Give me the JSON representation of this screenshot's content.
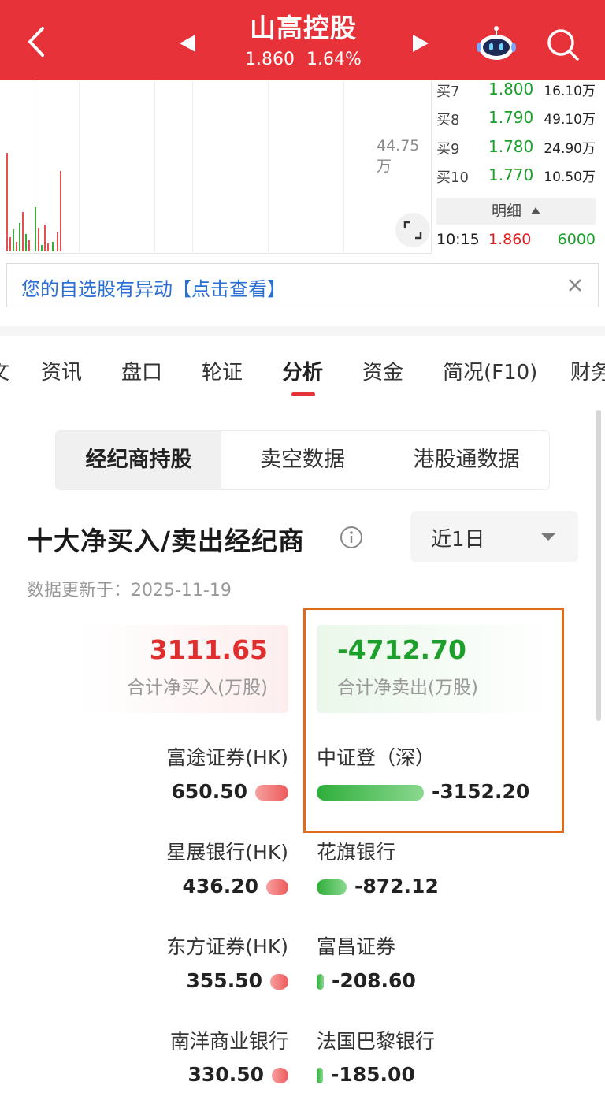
{
  "header": {
    "stock_name": "山高控股",
    "price": "1.860",
    "change_pct": "1.64%"
  },
  "chart": {
    "volume_label": "44.75万",
    "order_book": [
      {
        "label": "买7",
        "price": "1.800",
        "volume": "16.10万"
      },
      {
        "label": "买8",
        "price": "1.790",
        "volume": "49.10万"
      },
      {
        "label": "买9",
        "price": "1.780",
        "volume": "24.90万"
      },
      {
        "label": "买10",
        "price": "1.770",
        "volume": "10.50万"
      }
    ],
    "detail_label": "明细",
    "tick": {
      "time": "10:15",
      "price": "1.860",
      "volume": "6000"
    }
  },
  "notice": {
    "text": "您的自选股有异动【点击查看】"
  },
  "tabs": [
    {
      "label": "文"
    },
    {
      "label": "资讯"
    },
    {
      "label": "盘口"
    },
    {
      "label": "轮证"
    },
    {
      "label": "分析"
    },
    {
      "label": "资金"
    },
    {
      "label": "简况(F10)"
    },
    {
      "label": "财务"
    }
  ],
  "segments": [
    {
      "label": "经纪商持股"
    },
    {
      "label": "卖空数据"
    },
    {
      "label": "港股通数据"
    }
  ],
  "section": {
    "title": "十大净买入/卖出经纪商",
    "range": "近1日",
    "update_text": "数据更新于：2025-11-19"
  },
  "summary": {
    "buy_total": "3111.65",
    "buy_label": "合计净买入(万股)",
    "sell_total": "-4712.70",
    "sell_label": "合计净卖出(万股)"
  },
  "brokers": {
    "buy": [
      {
        "name": "富途证券(HK)",
        "value": "650.50",
        "amount": 650.5
      },
      {
        "name": "星展银行(HK)",
        "value": "436.20",
        "amount": 436.2
      },
      {
        "name": "东方证券(HK)",
        "value": "355.50",
        "amount": 355.5
      },
      {
        "name": "南洋商业银行",
        "value": "330.50",
        "amount": 330.5
      }
    ],
    "sell": [
      {
        "name": "中证登（深）",
        "value": "-3152.20",
        "amount": 3152.2
      },
      {
        "name": "花旗银行",
        "value": "-872.12",
        "amount": 872.12
      },
      {
        "name": "富昌证券",
        "value": "-208.60",
        "amount": 208.6
      },
      {
        "name": "法国巴黎银行",
        "value": "-185.00",
        "amount": 185.0
      }
    ]
  },
  "colors": {
    "brand_red": "#e8323a",
    "up_red": "#e02e2e",
    "down_green": "#1e9e2a",
    "highlight_orange": "#e06a1a",
    "link_blue": "#2a6fd6"
  }
}
